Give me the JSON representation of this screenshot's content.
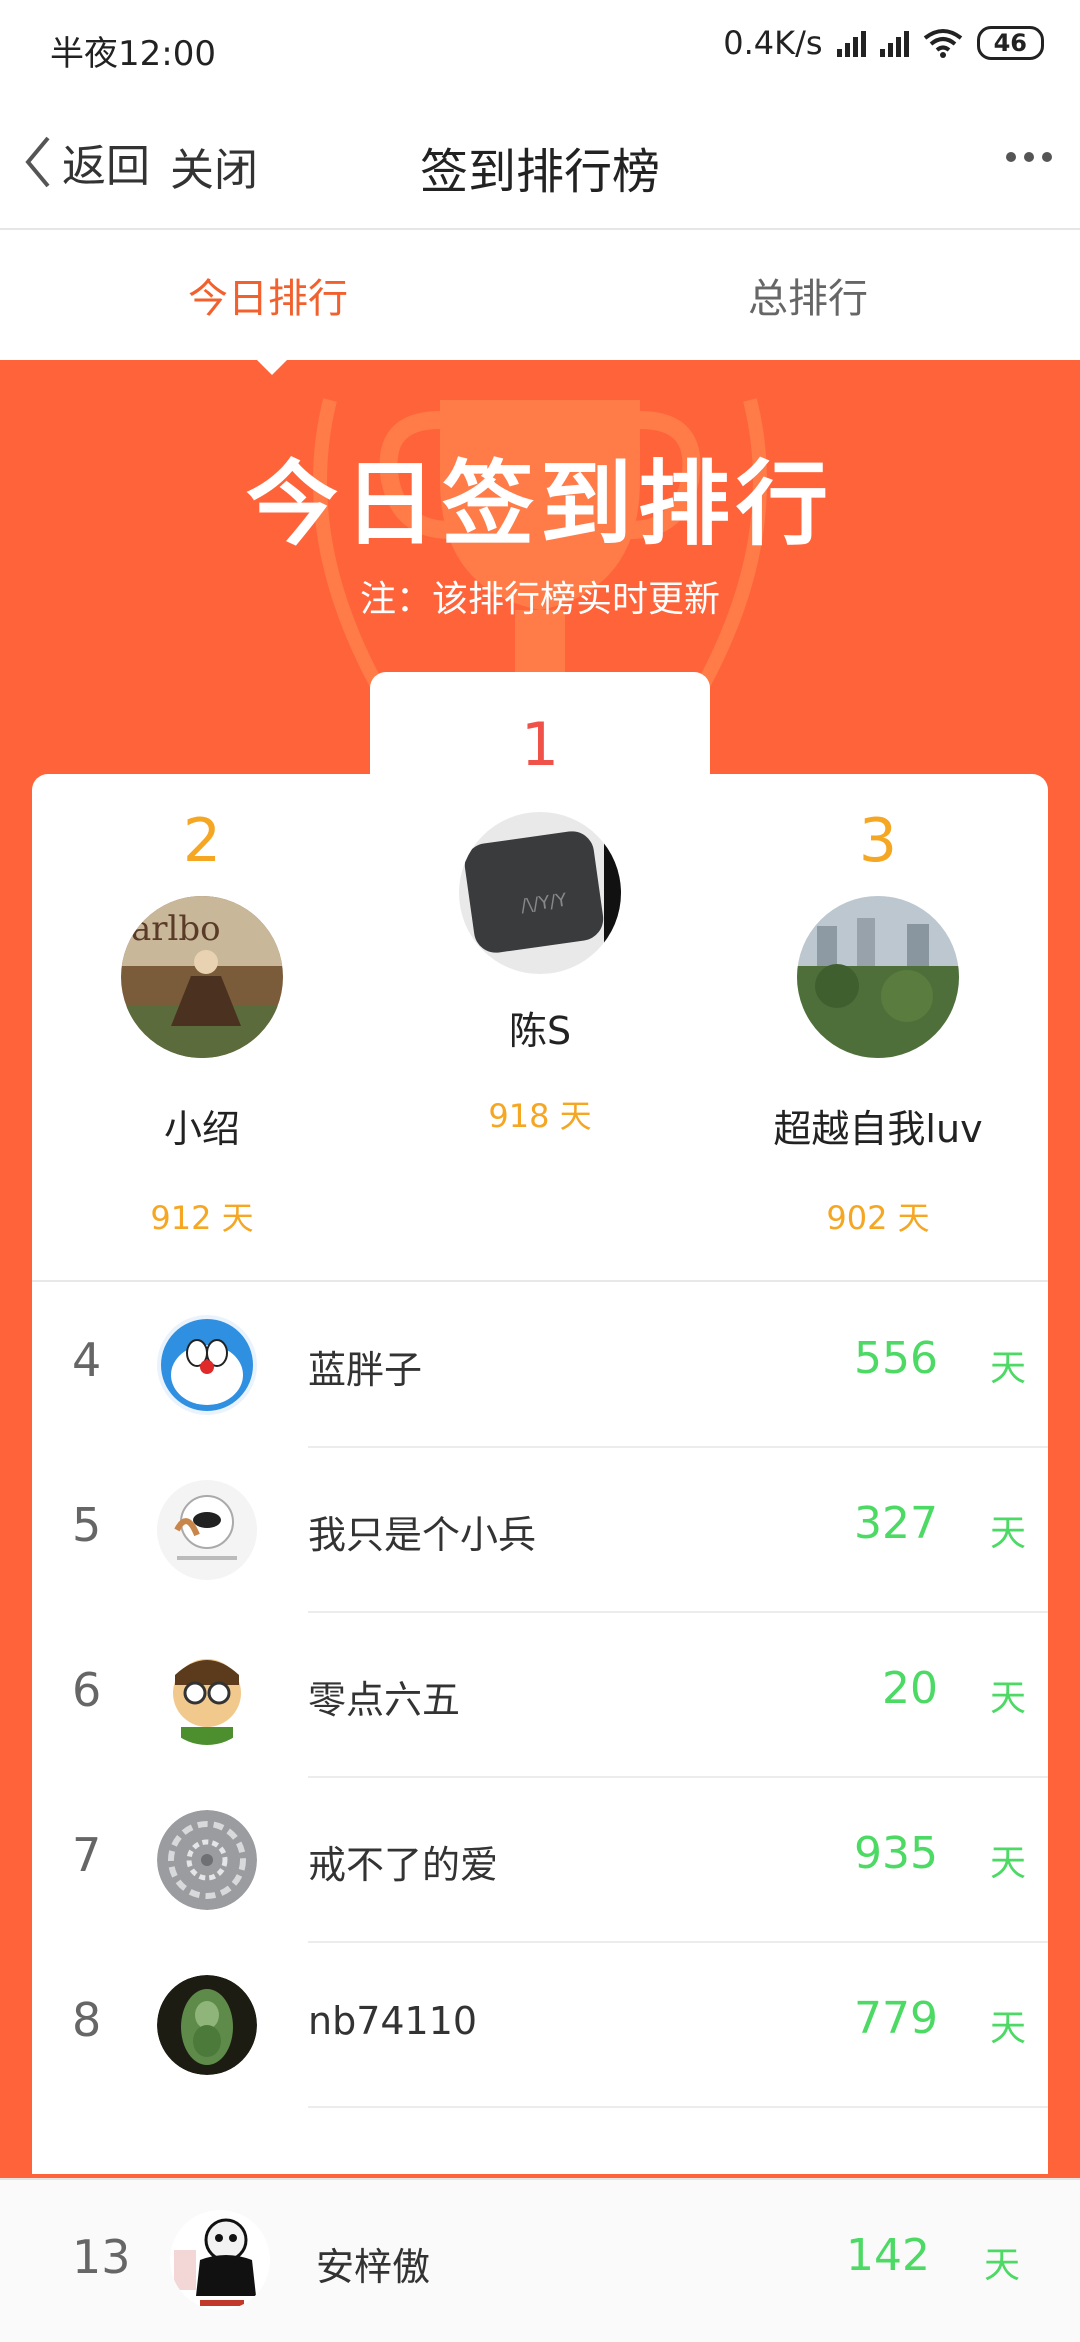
{
  "status": {
    "time": "半夜12:00",
    "speed": "0.4K/s",
    "battery": "46"
  },
  "nav": {
    "back": "返回",
    "close": "关闭",
    "title": "签到排行榜"
  },
  "tabs": {
    "today": "今日排行",
    "total": "总排行"
  },
  "banner": {
    "title": "今日签到排行",
    "note": "注：该排行榜实时更新"
  },
  "podium": {
    "first": {
      "rank": "1",
      "name": "陈S",
      "days": "918 天"
    },
    "second": {
      "rank": "2",
      "name": "小绍",
      "days": "912 天"
    },
    "third": {
      "rank": "3",
      "name": "超越自我luv",
      "days": "902 天"
    }
  },
  "list": [
    {
      "rank": "4",
      "name": "蓝胖子",
      "days": "556",
      "unit": "天"
    },
    {
      "rank": "5",
      "name": "我只是个小兵",
      "days": "327",
      "unit": "天"
    },
    {
      "rank": "6",
      "name": "零点六五",
      "days": "20",
      "unit": "天"
    },
    {
      "rank": "7",
      "name": "戒不了的爱",
      "days": "935",
      "unit": "天"
    },
    {
      "rank": "8",
      "name": "nb74110",
      "days": "779",
      "unit": "天"
    }
  ],
  "me": {
    "rank": "13",
    "name": "安梓傲",
    "days": "142",
    "unit": "天"
  },
  "colors": {
    "accent": "#ff633a",
    "tab_active": "#f2602e",
    "green": "#4cd964",
    "gold": "#f5a623"
  }
}
